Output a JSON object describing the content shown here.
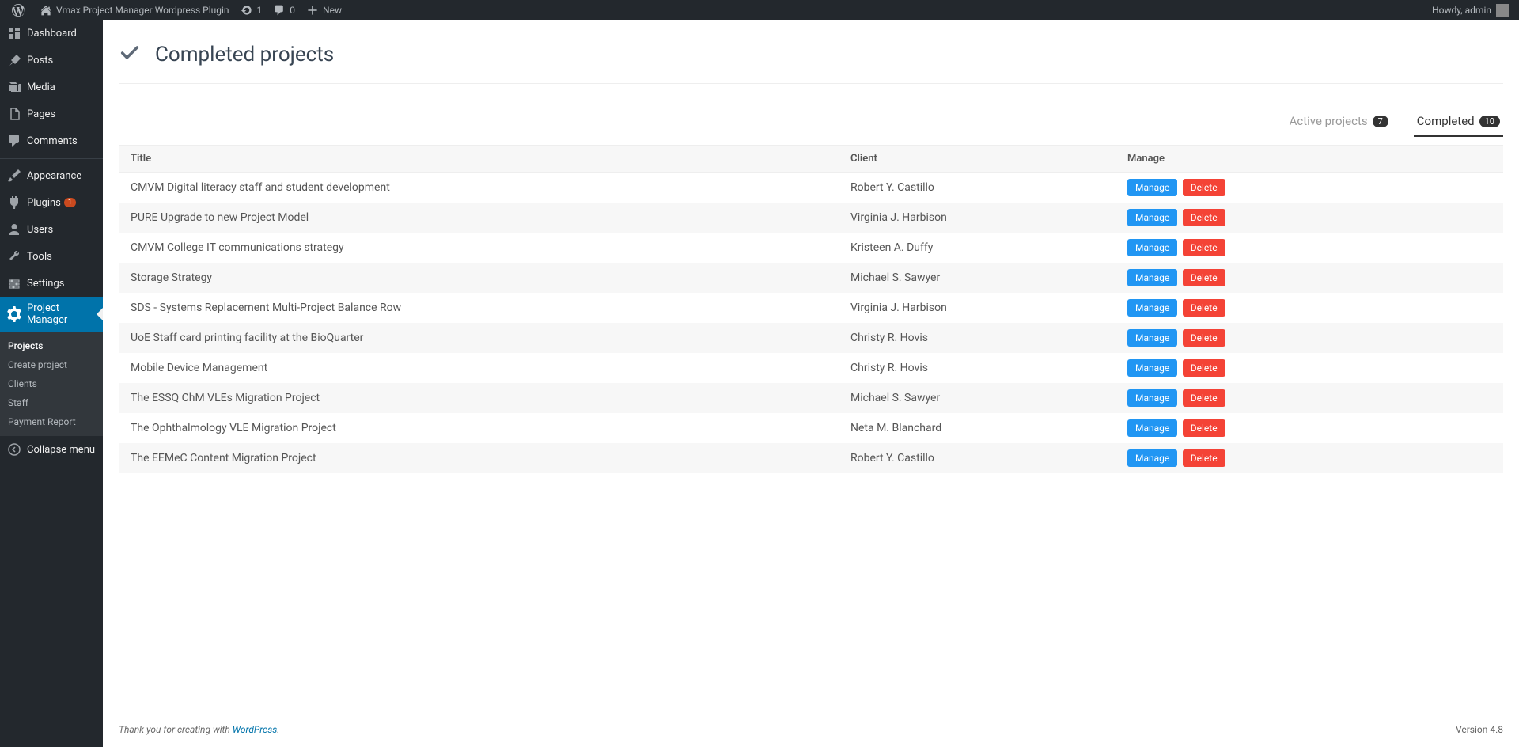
{
  "topbar": {
    "site_name": "Vmax Project Manager Wordpress Plugin",
    "refresh_count": "1",
    "comments_count": "0",
    "new_label": "New",
    "howdy": "Howdy, admin"
  },
  "sidebar": {
    "items": [
      {
        "label": "Dashboard",
        "icon": "dashboard"
      },
      {
        "label": "Posts",
        "icon": "pin"
      },
      {
        "label": "Media",
        "icon": "media"
      },
      {
        "label": "Pages",
        "icon": "pages"
      },
      {
        "label": "Comments",
        "icon": "comments"
      },
      {
        "label": "Appearance",
        "icon": "brush"
      },
      {
        "label": "Plugins",
        "icon": "plugin",
        "badge": "1"
      },
      {
        "label": "Users",
        "icon": "user"
      },
      {
        "label": "Tools",
        "icon": "tools"
      },
      {
        "label": "Settings",
        "icon": "settings"
      },
      {
        "label": "Project Manager",
        "icon": "gear",
        "active": true
      }
    ],
    "submenu": [
      {
        "label": "Projects",
        "current": true
      },
      {
        "label": "Create project"
      },
      {
        "label": "Clients"
      },
      {
        "label": "Staff"
      },
      {
        "label": "Payment Report"
      }
    ],
    "collapse": "Collapse menu"
  },
  "page": {
    "title": "Completed projects"
  },
  "tabs": {
    "active": {
      "label": "Active projects",
      "count": "7"
    },
    "completed": {
      "label": "Completed",
      "count": "10"
    }
  },
  "table": {
    "headers": {
      "title": "Title",
      "client": "Client",
      "manage": "Manage"
    },
    "manage_btn": "Manage",
    "delete_btn": "Delete",
    "rows": [
      {
        "title": "CMVM Digital literacy staff and student development",
        "client": "Robert Y. Castillo"
      },
      {
        "title": "PURE Upgrade to new Project Model",
        "client": "Virginia J. Harbison"
      },
      {
        "title": "CMVM College IT communications strategy",
        "client": "Kristeen A. Duffy"
      },
      {
        "title": "Storage Strategy",
        "client": "Michael S. Sawyer"
      },
      {
        "title": "SDS - Systems Replacement Multi-Project Balance Row",
        "client": "Virginia J. Harbison"
      },
      {
        "title": "UoE Staff card printing facility at the BioQuarter",
        "client": "Christy R. Hovis"
      },
      {
        "title": "Mobile Device Management",
        "client": "Christy R. Hovis"
      },
      {
        "title": "The ESSQ ChM VLEs Migration Project",
        "client": "Michael S. Sawyer"
      },
      {
        "title": "The Ophthalmology VLE Migration Project",
        "client": "Neta M. Blanchard"
      },
      {
        "title": "The EEMeC Content Migration Project",
        "client": "Robert Y. Castillo"
      }
    ]
  },
  "footer": {
    "thanks_prefix": "Thank you for creating with ",
    "wp": "WordPress",
    "period": ".",
    "version": "Version 4.8"
  }
}
